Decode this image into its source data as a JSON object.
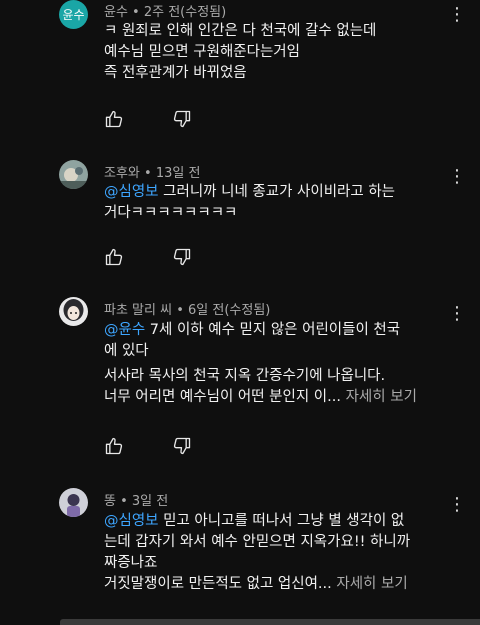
{
  "comments": [
    {
      "author": "윤수",
      "time": "2주 전(수정됨)",
      "avatar_text": "윤수",
      "lines": [
        {
          "mention": "",
          "text": "ㅋ  원죄로 인해 인간은 다 천국에 갈수 없는데"
        },
        {
          "mention": "",
          "text": " 예수님 믿으면 구원해준다는거임"
        },
        {
          "mention": "",
          "text": " 즉 전후관계가 바뀌었음"
        }
      ],
      "more": ""
    },
    {
      "author": "조후와",
      "time": "13일 전",
      "avatar_text": "",
      "lines": [
        {
          "mention": "@심영보",
          "text": "  그러니까 니네 종교가 사이비라고 하는"
        },
        {
          "mention": "",
          "text": "거다ㅋㅋㅋㅋㅋㅋㅋㅋ"
        }
      ],
      "more": ""
    },
    {
      "author": "파초 말리 씨",
      "time": "6일 전(수정됨)",
      "avatar_text": "",
      "lines": [
        {
          "mention": "@윤수",
          "text": "  7세 이하 예수 믿지 않은 어린이들이 천국"
        },
        {
          "mention": "",
          "text": "에 있다"
        },
        {
          "mention": "",
          "text": "서사라 목사의 천국 지옥 간증수기에 나옵니다."
        },
        {
          "mention": "",
          "text": "너무 어리면 예수님이 어떤 분인지 이... "
        }
      ],
      "more": "자세히 보기"
    },
    {
      "author": "똥",
      "time": "3일 전",
      "avatar_text": "",
      "lines": [
        {
          "mention": "@심영보",
          "text": "  믿고 아니고를 떠나서 그냥 별 생각이 없"
        },
        {
          "mention": "",
          "text": "는데 갑자기 와서 예수 안믿으면 지옥가요!! 하니까"
        },
        {
          "mention": "",
          "text": "짜증나죠"
        },
        {
          "mention": "",
          "text": "거짓말쟁이로 만든적도 없고 업신여... "
        }
      ],
      "more": "자세히 보기"
    }
  ],
  "meta_separator": " • ",
  "icons": {
    "like": "thumb-up-outline",
    "dislike": "thumb-down-outline",
    "menu": "vertical-dots"
  },
  "colors": {
    "background": "#0f0f0f",
    "mention": "#3ea6ff",
    "muted": "#aaaaaa",
    "text": "#f1f1f1"
  }
}
